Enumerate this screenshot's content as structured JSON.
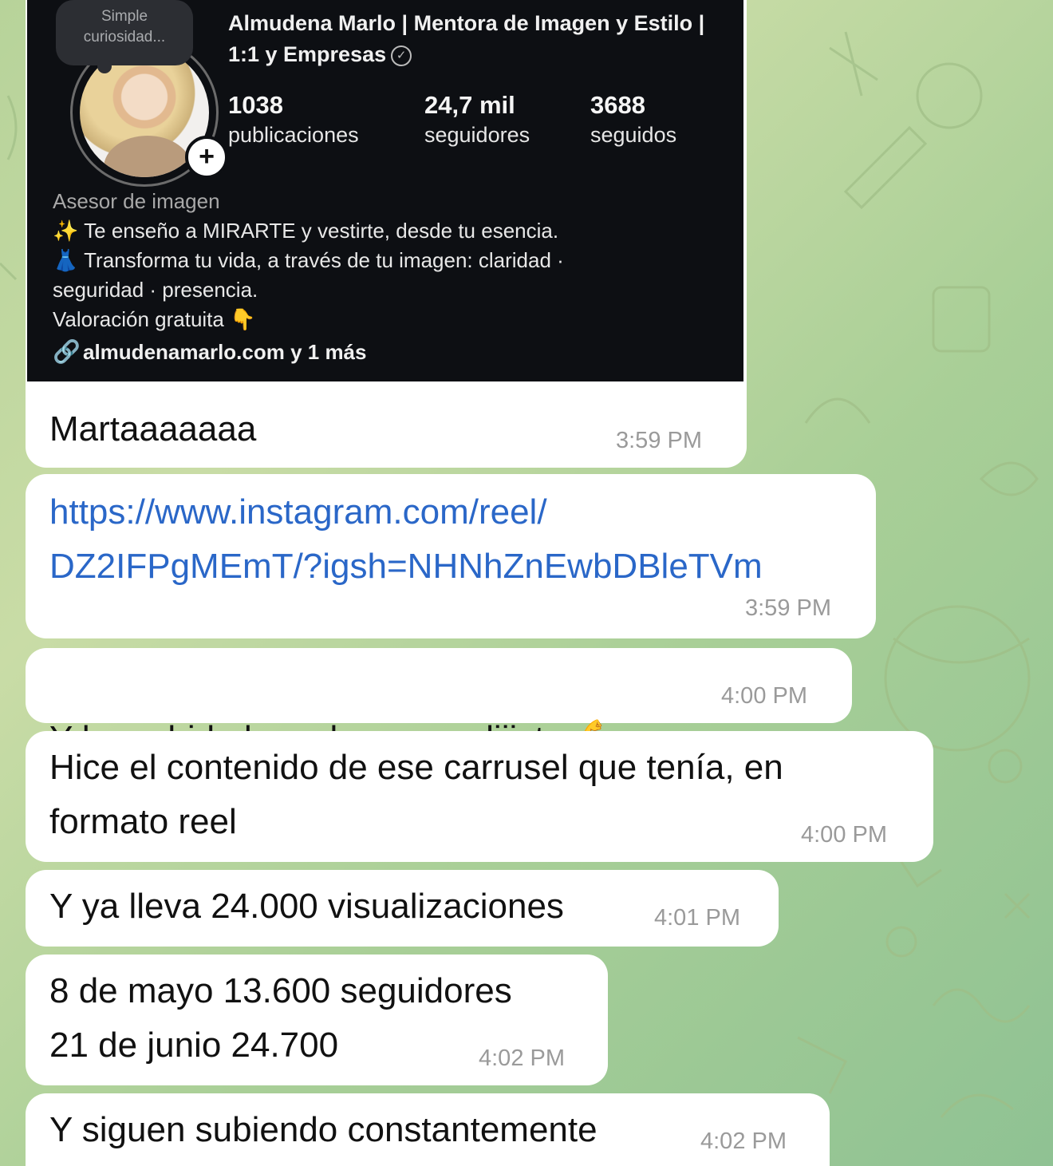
{
  "profile_card": {
    "note": "Simple curiosidad...",
    "name": "Almudena Marlo | Mentora de Imagen y Estilo | 1:1 y Empresas",
    "stats": [
      {
        "value": "1038",
        "label": "publicaciones"
      },
      {
        "value": "24,7 mil",
        "label": "seguidores"
      },
      {
        "value": "3688",
        "label": "seguidos"
      }
    ],
    "category": "Asesor de imagen",
    "bio_lines": [
      "Te enseño a MIRARTE y vestirte, desde tu esencia.",
      "Transforma tu vida, a través de tu imagen: claridad ·",
      "seguridad · presencia.",
      "Valoración gratuita"
    ],
    "link": "almudenamarlo.com y 1 más"
  },
  "messages": [
    {
      "text": "Martaaaaaaa",
      "time": "3:59 PM"
    },
    {
      "text": "https://www.instagram.com/reel/\nDZ2IFPgMEmT/?igsh=NHNhZnEwbDBleTVm",
      "time": "3:59 PM"
    },
    {
      "text": "Y he subido hoy el que me dijiste",
      "time": "4:00 PM"
    },
    {
      "text": "Hice el contenido de ese carrusel que tenía, en\nformato reel",
      "time": "4:00 PM"
    },
    {
      "text": "Y ya lleva 24.000 visualizaciones",
      "time": "4:01 PM"
    },
    {
      "text": "8 de mayo 13.600 seguidores\n21 de junio 24.700",
      "time": "4:02 PM"
    },
    {
      "text": "Y siguen subiendo constantemente",
      "time": "4:02 PM"
    }
  ],
  "icons": {
    "muscle": "💪",
    "sparkles": "✨",
    "dress": "👗",
    "pointing_down": "👇",
    "link": "🔗",
    "verified": "verified-check-icon"
  }
}
